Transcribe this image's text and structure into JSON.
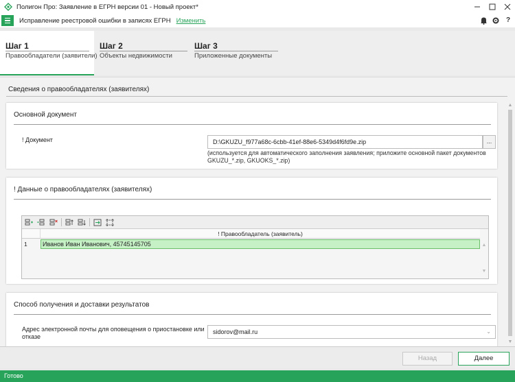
{
  "window": {
    "title": "Полигон Про: Заявление в ЕГРН версии 01 - Новый проект*",
    "controls": [
      "minimize",
      "maximize",
      "close"
    ]
  },
  "toolbar": {
    "project_name": "Исправление реестровой ошибки в записях ЕГРН",
    "change_link": "Изменить",
    "icons": [
      "bell-icon",
      "gear-icon",
      "help-icon"
    ]
  },
  "steps": [
    {
      "name": "Шаг 1",
      "description": "Правообладатели (заявители)",
      "active": true
    },
    {
      "name": "Шаг 2",
      "description": "Объекты недвижимости",
      "active": false
    },
    {
      "name": "Шаг 3",
      "description": "Приложенные документы",
      "active": false
    }
  ],
  "main": {
    "title": "Сведения о правообладателях (заявителях)"
  },
  "main_document": {
    "title": "Основной документ",
    "field_label": "! Документ",
    "field_value": "D:\\GKUZU_f977a68c-6cbb-41ef-88e6-5349d4f6fd9e.zip",
    "browse_label": "...",
    "hint": "(используется для автоматического заполнения заявления; приложите основной пакет документов GKUZU_*.zip, GKUOKS_*.zip)"
  },
  "owners": {
    "title": "! Данные о правообладателях (заявителях)",
    "column_header": "! Правообладатель (заявитель)",
    "rows": [
      {
        "num": "1",
        "value": "Иванов Иван Иванович, 45745145705"
      }
    ]
  },
  "delivery": {
    "title": "Способ получения и доставки результатов",
    "email_label": "Адрес электронной почты для оповещения о приостановке или отказе",
    "email_value": "sidorov@mail.ru"
  },
  "footer": {
    "back_label": "Назад",
    "next_label": "Далее"
  },
  "status": {
    "text": "Готово"
  },
  "colors": {
    "accent": "#27a35a",
    "row_highlight": "#c6f0c6"
  }
}
